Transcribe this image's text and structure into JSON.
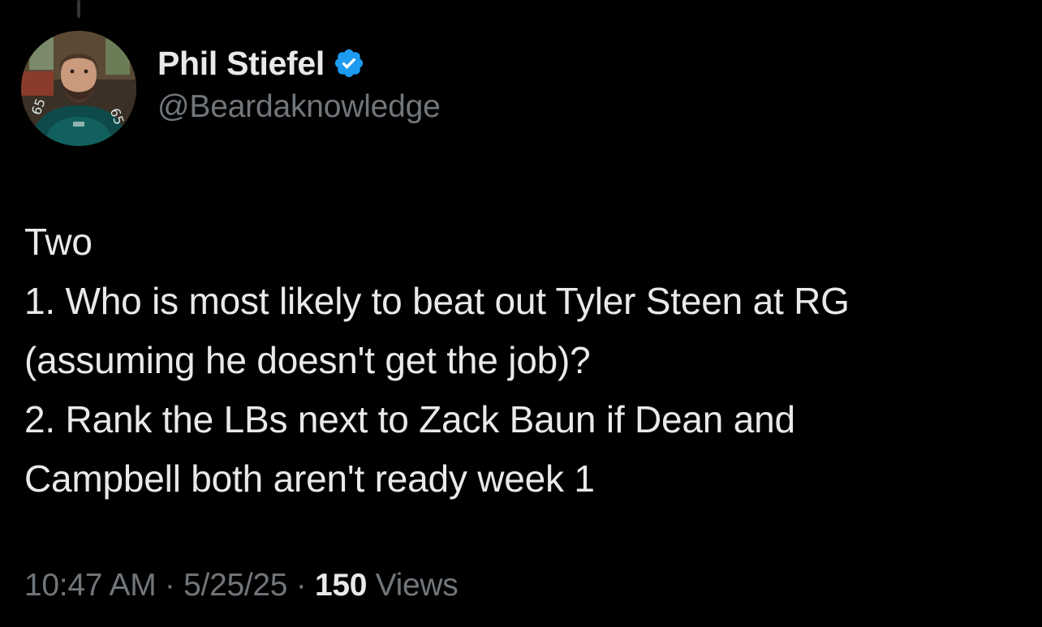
{
  "author": {
    "display_name": "Phil Stiefel",
    "handle": "@Beardaknowledge",
    "verified": true,
    "verified_color": "#1d9bf0",
    "avatar_icon": "profile-photo-avatar"
  },
  "tweet": {
    "lines": [
      "Two",
      "1. Who is most likely to beat out Tyler Steen at RG",
      "(assuming he doesn't get the job)?",
      "2. Rank the LBs next to Zack Baun if Dean and",
      "Campbell both aren't ready week 1"
    ]
  },
  "meta": {
    "time": "10:47 AM",
    "separator": " · ",
    "date": "5/25/25",
    "views_count": "150",
    "views_label": " Views"
  },
  "colors": {
    "background": "#000000",
    "primary_text": "#e7e9ea",
    "secondary_text": "#71767b"
  }
}
